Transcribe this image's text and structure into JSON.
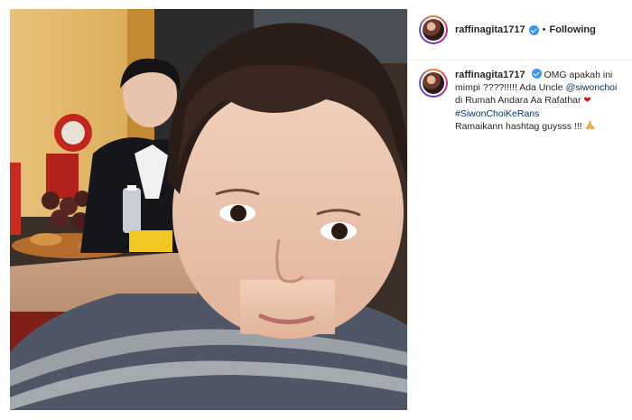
{
  "post": {
    "username": "raffinagita1717",
    "follow_status": "Following",
    "separator": "•",
    "caption": {
      "line1_text": "OMG apakah ini",
      "line2_text": "mimpi ????!!!!! Ada Uncle ",
      "mention": "@siwonchoi",
      "line3_text": "di Rumah Andara Aa Rafathar ",
      "heart": "❤",
      "hashtag": "#SiwonChoiKeRans",
      "line5_text": "Ramaikann hashtag guysss !!! "
    }
  },
  "icons": {
    "verified": "verified-badge-icon",
    "praying_hands": "praying-hands-emoji",
    "heart": "red-heart-emoji"
  },
  "colors": {
    "verified_blue": "#3897f0",
    "link_blue": "#00376b",
    "heart_red": "#d51c1c"
  }
}
